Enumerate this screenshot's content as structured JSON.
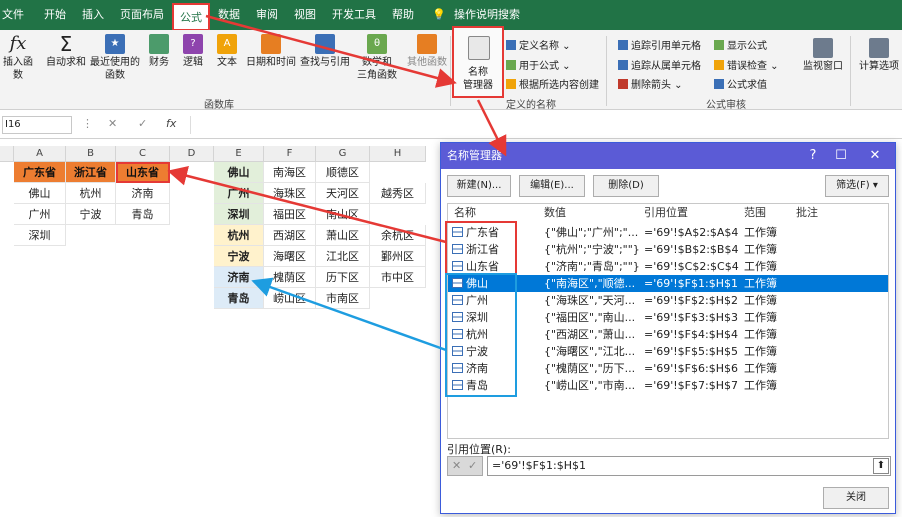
{
  "menu": [
    "文件",
    "开始",
    "插入",
    "页面布局",
    "公式",
    "数据",
    "审阅",
    "视图",
    "开发工具",
    "帮助",
    "操作说明搜索"
  ],
  "ribbon": {
    "insert_function": "插入函数",
    "autosum": "自动求和",
    "recent": "最近使用的",
    "recent2": "函数",
    "finance": "财务",
    "logic": "逻辑",
    "text": "文本",
    "datetime": "日期和时间",
    "lookup": "查找与引用",
    "math1": "数学和",
    "math2": "三角函数",
    "other": "其他函数",
    "library_label": "函数库",
    "name_manager1": "名称",
    "name_manager2": "管理器",
    "define_name": "定义名称",
    "use_in_formula": "用于公式",
    "create_from_selection": "根据所选内容创建",
    "defined_names_label": "定义的名称",
    "trace_precedents": "追踪引用单元格",
    "trace_dependents": "追踪从属单元格",
    "remove_arrows": "删除箭头",
    "show_formulas": "显示公式",
    "error_checking": "错误检查",
    "evaluate_formula": "公式求值",
    "audit_label": "公式审核",
    "watch_window": "监视窗口",
    "calc_options": "计算选项"
  },
  "formula_bar": {
    "namebox": "I16",
    "fx": "fx"
  },
  "sheet": {
    "columns": [
      "A",
      "B",
      "C",
      "D",
      "E",
      "F",
      "G",
      "H"
    ],
    "left_headers": [
      "广东省",
      "浙江省",
      "山东省"
    ],
    "left_rows": [
      [
        "佛山",
        "杭州",
        "济南"
      ],
      [
        "广州",
        "宁波",
        "青岛"
      ],
      [
        "深圳",
        "",
        ""
      ]
    ],
    "right_rows": [
      [
        "佛山",
        "南海区",
        "顺德区",
        ""
      ],
      [
        "广州",
        "海珠区",
        "天河区",
        "越秀区"
      ],
      [
        "深圳",
        "福田区",
        "南山区",
        ""
      ],
      [
        "杭州",
        "西湖区",
        "萧山区",
        "余杭区"
      ],
      [
        "宁波",
        "海曙区",
        "江北区",
        "鄞州区"
      ],
      [
        "济南",
        "槐荫区",
        "历下区",
        "市中区"
      ],
      [
        "青岛",
        "崂山区",
        "市南区",
        ""
      ]
    ]
  },
  "dialog": {
    "title": "名称管理器",
    "new": "新建(N)...",
    "edit": "编辑(E)...",
    "delete": "删除(D)",
    "filter": "筛选(F)",
    "cols": [
      "名称",
      "数值",
      "引用位置",
      "范围",
      "批注"
    ],
    "rows": [
      [
        "广东省",
        "{\"佛山\";\"广州\";\"...",
        "='69'!$A$2:$A$4",
        "工作簿"
      ],
      [
        "浙江省",
        "{\"杭州\";\"宁波\";\"\"}",
        "='69'!$B$2:$B$4",
        "工作簿"
      ],
      [
        "山东省",
        "{\"济南\";\"青岛\";\"\"}",
        "='69'!$C$2:$C$4",
        "工作簿"
      ],
      [
        "佛山",
        "{\"南海区\",\"顺德...",
        "='69'!$F$1:$H$1",
        "工作簿"
      ],
      [
        "广州",
        "{\"海珠区\",\"天河...",
        "='69'!$F$2:$H$2",
        "工作簿"
      ],
      [
        "深圳",
        "{\"福田区\",\"南山...",
        "='69'!$F$3:$H$3",
        "工作簿"
      ],
      [
        "杭州",
        "{\"西湖区\",\"萧山...",
        "='69'!$F$4:$H$4",
        "工作簿"
      ],
      [
        "宁波",
        "{\"海曙区\",\"江北...",
        "='69'!$F$5:$H$5",
        "工作簿"
      ],
      [
        "济南",
        "{\"槐荫区\",\"历下...",
        "='69'!$F$6:$H$6",
        "工作簿"
      ],
      [
        "青岛",
        "{\"崂山区\",\"市南...",
        "='69'!$F$7:$H$7",
        "工作簿"
      ]
    ],
    "ref_label": "引用位置(R):",
    "ref_value": "='69'!$F$1:$H$1",
    "close": "关闭"
  },
  "colors": {
    "excel_green": "#217346",
    "highlight_red": "#e53935",
    "highlight_blue": "#1e9de0",
    "selection": "#0078d7",
    "title_bar": "#5b5bd6"
  }
}
